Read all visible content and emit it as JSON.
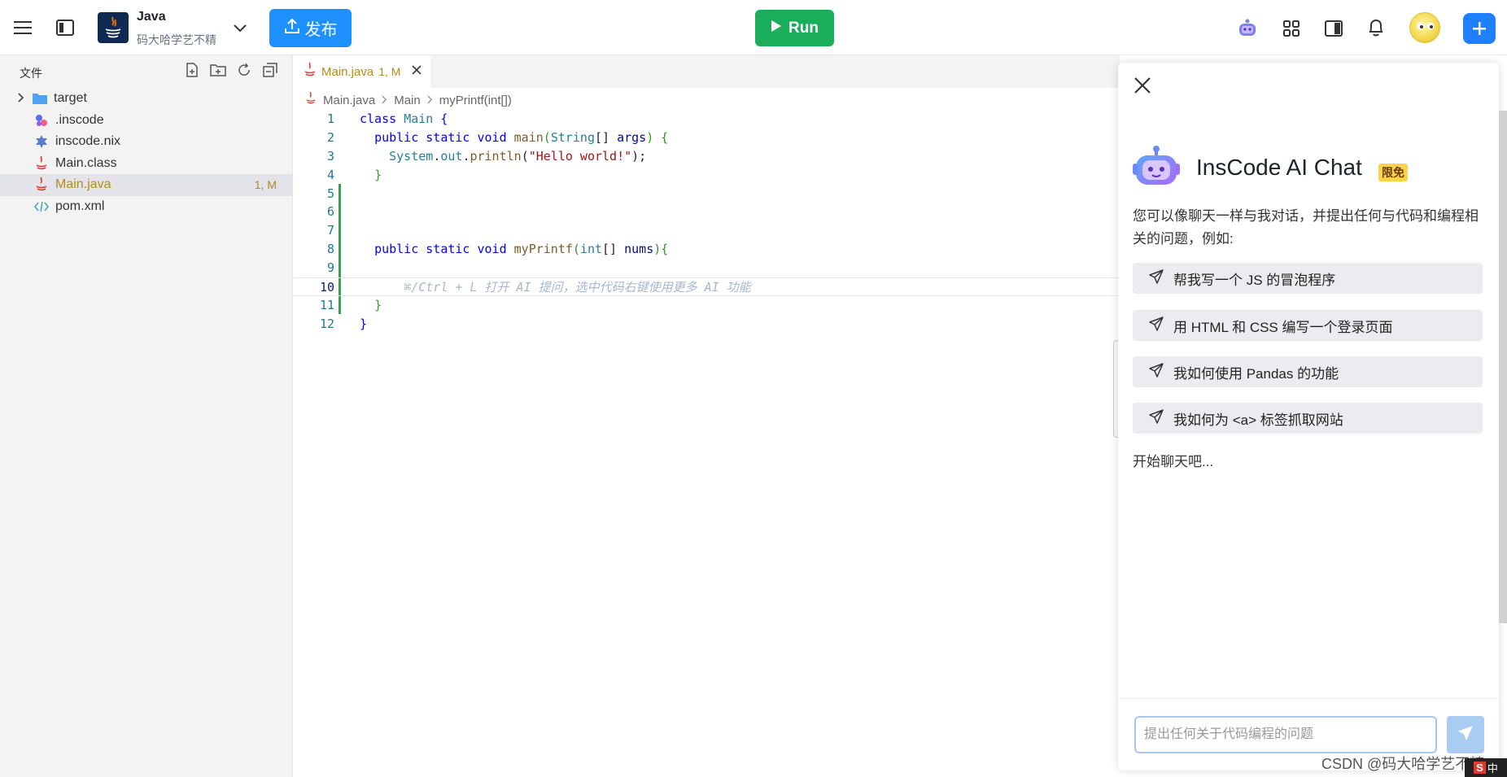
{
  "header": {
    "menu_icon": "hamburger-icon",
    "sidebar_toggle_icon": "panel-icon",
    "project": {
      "name": "Java",
      "owner": "码大哈学艺不精"
    },
    "publish_label": "发布",
    "run_label": "Run",
    "right_icons": [
      "ai-bot-icon",
      "grid-icon",
      "layout-icon",
      "bell-icon"
    ]
  },
  "sidebar": {
    "title": "文件",
    "actions": [
      "new-file-icon",
      "new-folder-icon",
      "refresh-icon",
      "collapse-icon"
    ],
    "items": [
      {
        "label": "target",
        "type": "folder",
        "icon": "folder-icon"
      },
      {
        "label": ".inscode",
        "type": "file",
        "icon": "inscode-icon"
      },
      {
        "label": "inscode.nix",
        "type": "file",
        "icon": "nix-icon"
      },
      {
        "label": "Main.class",
        "type": "file",
        "icon": "java-icon"
      },
      {
        "label": "Main.java",
        "type": "file",
        "icon": "java-icon",
        "badge": "1, M",
        "active": true
      },
      {
        "label": "pom.xml",
        "type": "file",
        "icon": "xml-icon"
      }
    ]
  },
  "editor": {
    "tab": {
      "label": "Main.java",
      "badge": "1, M"
    },
    "breadcrumb": [
      "Main.java",
      "Main",
      "myPrintf(int[])"
    ],
    "lines": [
      {
        "n": "1"
      },
      {
        "n": "2"
      },
      {
        "n": "3"
      },
      {
        "n": "4"
      },
      {
        "n": "5"
      },
      {
        "n": "6"
      },
      {
        "n": "7"
      },
      {
        "n": "8"
      },
      {
        "n": "9"
      },
      {
        "n": "10"
      },
      {
        "n": "11"
      },
      {
        "n": "12"
      }
    ],
    "code": {
      "l1": [
        "class",
        "Main",
        "{"
      ],
      "l2": [
        "public",
        "static",
        "void",
        "main",
        "(",
        "String",
        "[] ",
        "args",
        ") {"
      ],
      "l3": [
        "System",
        ".",
        "out",
        ".",
        "println",
        "(",
        "\"Hello world!\"",
        ");"
      ],
      "l4": [
        "}"
      ],
      "l8": [
        "public",
        "static",
        "void",
        "myPrintf",
        "(",
        "int",
        "[] ",
        "nums",
        "){"
      ],
      "l10_hint": "⌘/Ctrl + L 打开 AI 提问，选中代码右键使用更多 AI 功能",
      "l11": [
        "}"
      ],
      "l12": [
        "}"
      ]
    }
  },
  "chat": {
    "title": "InsCode AI Chat",
    "tag": "限免",
    "intro": "您可以像聊天一样与我对话，并提出任何与代码和编程相关的问题，例如:",
    "suggestions": [
      "帮我写一个 JS 的冒泡程序",
      "用 HTML 和 CSS 编写一个登录页面",
      "我如何使用 Pandas 的功能",
      "我如何为 <a> 标签抓取网站"
    ],
    "start_text": "开始聊天吧...",
    "input_placeholder": "提出任何关于代码编程的问题"
  },
  "footer": {
    "watermark": "CSDN @码大哈学艺不精",
    "ime_label": "中",
    "ime_logo": "S"
  },
  "colors": {
    "publish": "#1e90ff",
    "run": "#1aae5a",
    "add": "#1e80ff",
    "modified": "#b58a1a",
    "tag": "#fcd34d"
  }
}
